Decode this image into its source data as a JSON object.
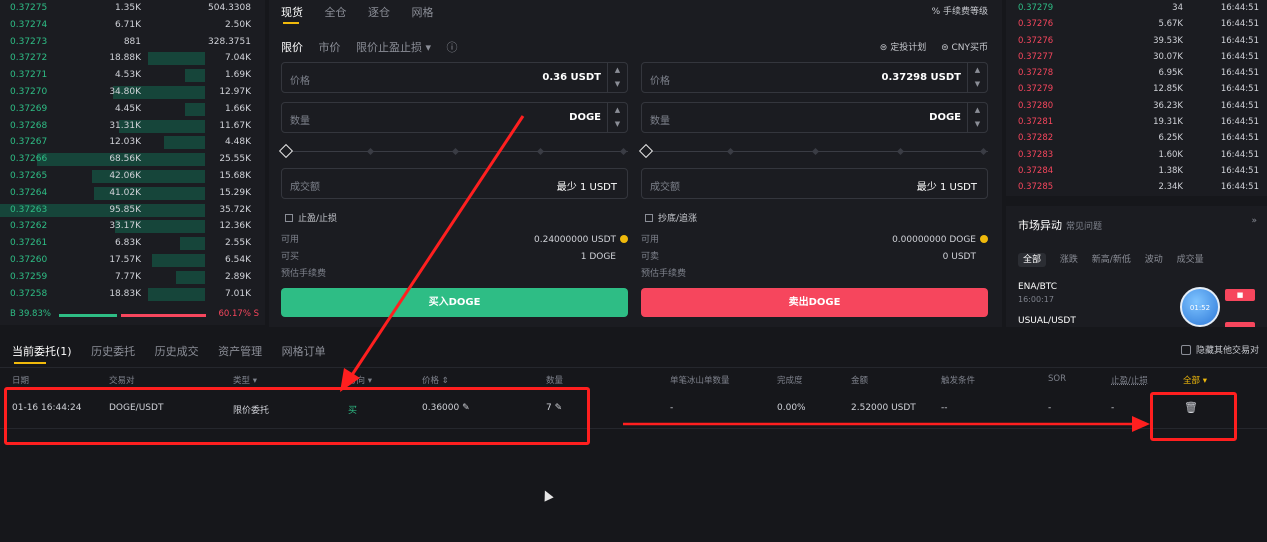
{
  "orderbook_left": {
    "rows": [
      {
        "price": "0.37275",
        "qty": "1.35K",
        "total": "504.3308",
        "depth": 0
      },
      {
        "price": "0.37274",
        "qty": "6.71K",
        "total": "2.50K",
        "depth": 0
      },
      {
        "price": "0.37273",
        "qty": "881",
        "total": "328.3751",
        "depth": 0
      },
      {
        "price": "0.37272",
        "qty": "18.88K",
        "total": "7.04K",
        "depth": 0.28
      },
      {
        "price": "0.37271",
        "qty": "4.53K",
        "total": "1.69K",
        "depth": 0.1
      },
      {
        "price": "0.37270",
        "qty": "34.80K",
        "total": "12.97K",
        "depth": 0.45
      },
      {
        "price": "0.37269",
        "qty": "4.45K",
        "total": "1.66K",
        "depth": 0.1
      },
      {
        "price": "0.37268",
        "qty": "31.31K",
        "total": "11.67K",
        "depth": 0.42
      },
      {
        "price": "0.37267",
        "qty": "12.03K",
        "total": "4.48K",
        "depth": 0.2
      },
      {
        "price": "0.37266",
        "qty": "68.56K",
        "total": "25.55K",
        "depth": 0.82
      },
      {
        "price": "0.37265",
        "qty": "42.06K",
        "total": "15.68K",
        "depth": 0.55
      },
      {
        "price": "0.37264",
        "qty": "41.02K",
        "total": "15.29K",
        "depth": 0.54
      },
      {
        "price": "0.37263",
        "qty": "95.85K",
        "total": "35.72K",
        "depth": 1.0
      },
      {
        "price": "0.37262",
        "qty": "33.17K",
        "total": "12.36K",
        "depth": 0.44
      },
      {
        "price": "0.37261",
        "qty": "6.83K",
        "total": "2.55K",
        "depth": 0.12
      },
      {
        "price": "0.37260",
        "qty": "17.57K",
        "total": "6.54K",
        "depth": 0.26
      },
      {
        "price": "0.37259",
        "qty": "7.77K",
        "total": "2.89K",
        "depth": 0.14
      },
      {
        "price": "0.37258",
        "qty": "18.83K",
        "total": "7.01K",
        "depth": 0.28
      }
    ],
    "buy_ratio": "B 39.83%",
    "sell_ratio": "60.17% S"
  },
  "trade_panel": {
    "tabs": [
      "现货",
      "全仓",
      "逐仓",
      "网格"
    ],
    "fee_level": "% 手续费等级",
    "order_types": [
      "限价",
      "市价",
      "限价止盈止损 ▾"
    ],
    "info_icon": "ⓘ",
    "tools": [
      "⊜ 定投计划",
      "⊜ CNY买币"
    ],
    "buy": {
      "price_label": "价格",
      "price_value": "0.36 USDT",
      "qty_label": "数量",
      "qty_value": "DOGE",
      "amount_label": "成交额",
      "amount_value": "最少 1  USDT",
      "checkbox": "止盈/止损",
      "avail_label": "可用",
      "avail_value": "0.24000000 USDT",
      "max_label": "可买",
      "max_value": "1 DOGE",
      "fee_label": "预估手续费",
      "button": "买入DOGE"
    },
    "sell": {
      "price_label": "价格",
      "price_value": "0.37298 USDT",
      "qty_label": "数量",
      "qty_value": "DOGE",
      "amount_label": "成交额",
      "amount_value": "最少 1  USDT",
      "checkbox": "抄底/追涨",
      "avail_label": "可用",
      "avail_value": "0.00000000 DOGE",
      "max_label": "可卖",
      "max_value": "0 USDT",
      "fee_label": "预估手续费",
      "button": "卖出DOGE"
    },
    "stepper_up": "▲",
    "stepper_down": "▼"
  },
  "trades_right": {
    "rows": [
      {
        "price": "0.37279",
        "qty": "34",
        "time": "16:44:51",
        "side": "buy"
      },
      {
        "price": "0.37276",
        "qty": "5.67K",
        "time": "16:44:51",
        "side": "sell"
      },
      {
        "price": "0.37276",
        "qty": "39.53K",
        "time": "16:44:51",
        "side": "sell"
      },
      {
        "price": "0.37277",
        "qty": "30.07K",
        "time": "16:44:51",
        "side": "sell"
      },
      {
        "price": "0.37278",
        "qty": "6.95K",
        "time": "16:44:51",
        "side": "sell"
      },
      {
        "price": "0.37279",
        "qty": "12.85K",
        "time": "16:44:51",
        "side": "sell"
      },
      {
        "price": "0.37280",
        "qty": "36.23K",
        "time": "16:44:51",
        "side": "sell"
      },
      {
        "price": "0.37281",
        "qty": "19.31K",
        "time": "16:44:51",
        "side": "sell"
      },
      {
        "price": "0.37282",
        "qty": "6.25K",
        "time": "16:44:51",
        "side": "sell"
      },
      {
        "price": "0.37283",
        "qty": "1.60K",
        "time": "16:44:51",
        "side": "sell"
      },
      {
        "price": "0.37284",
        "qty": "1.38K",
        "time": "16:44:51",
        "side": "sell"
      },
      {
        "price": "0.37285",
        "qty": "2.34K",
        "time": "16:44:51",
        "side": "sell"
      }
    ]
  },
  "market_moves": {
    "title": "市场异动",
    "subtitle": "常见问题",
    "collapse": "»",
    "tabs": [
      "全部",
      "涨跌",
      "新高/新低",
      "波动",
      "成交量"
    ],
    "items": [
      {
        "pair": "ENA/BTC",
        "time": "16:00:17",
        "badge": "■"
      },
      {
        "pair": "USUAL/USDT",
        "time": "",
        "badge": ""
      }
    ],
    "bubble": "01:52"
  },
  "orders": {
    "tabs": [
      "当前委托(1)",
      "历史委托",
      "历史成交",
      "资产管理",
      "网格订单"
    ],
    "hide_other": "隐藏其他交易对",
    "headers": [
      "日期",
      "交易对",
      "类型 ▾",
      "方向 ▾",
      "价格 ⇕",
      "数量",
      "单笔冰山单数量",
      "完成度",
      "金额",
      "触发条件",
      "SOR",
      "止盈/止损",
      "全部 ▾"
    ],
    "row": {
      "date": "01-16 16:44:24",
      "pair": "DOGE/USDT",
      "type": "限价委托",
      "side": "买",
      "price": "0.36000",
      "qty": "7",
      "iceberg": "-",
      "filled": "0.00%",
      "amount": "2.52000 USDT",
      "trigger": "--",
      "sor": "-",
      "tpsl": "-"
    },
    "edit_icon": "✎",
    "delete_icon": "🗑"
  }
}
